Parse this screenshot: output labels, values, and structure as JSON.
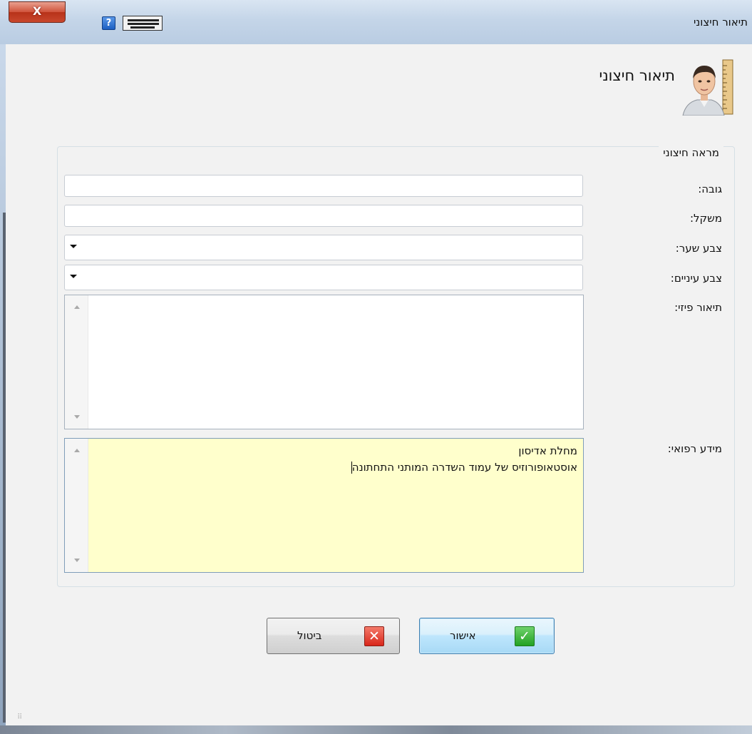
{
  "window": {
    "title": "תיאור חיצוני",
    "close_label": "X",
    "help_label": "?"
  },
  "header": {
    "title": "תיאור חיצוני",
    "icon": "person-with-ruler-icon"
  },
  "panel": {
    "legend": "מראה חיצוני",
    "fields": {
      "height": {
        "label": "גובה:",
        "value": ""
      },
      "weight": {
        "label": "משקל:",
        "value": ""
      },
      "hair_color": {
        "label": "צבע שער:",
        "value": ""
      },
      "eye_color": {
        "label": "צבע עיניים:",
        "value": ""
      },
      "physical_description": {
        "label": "תיאור פיזי:",
        "value": ""
      },
      "medical_info": {
        "label": "מידע רפואי:",
        "lines": [
          "מחלת אדיסון",
          "אוסטאופורוזיס של עמוד השדרה המותני התחתונה"
        ],
        "background": "#ffffcc"
      }
    }
  },
  "buttons": {
    "ok": {
      "label": "אישור",
      "icon": "checkmark-icon",
      "icon_glyph": "✓"
    },
    "cancel": {
      "label": "ביטול",
      "icon": "x-icon",
      "icon_glyph": "✕"
    }
  }
}
